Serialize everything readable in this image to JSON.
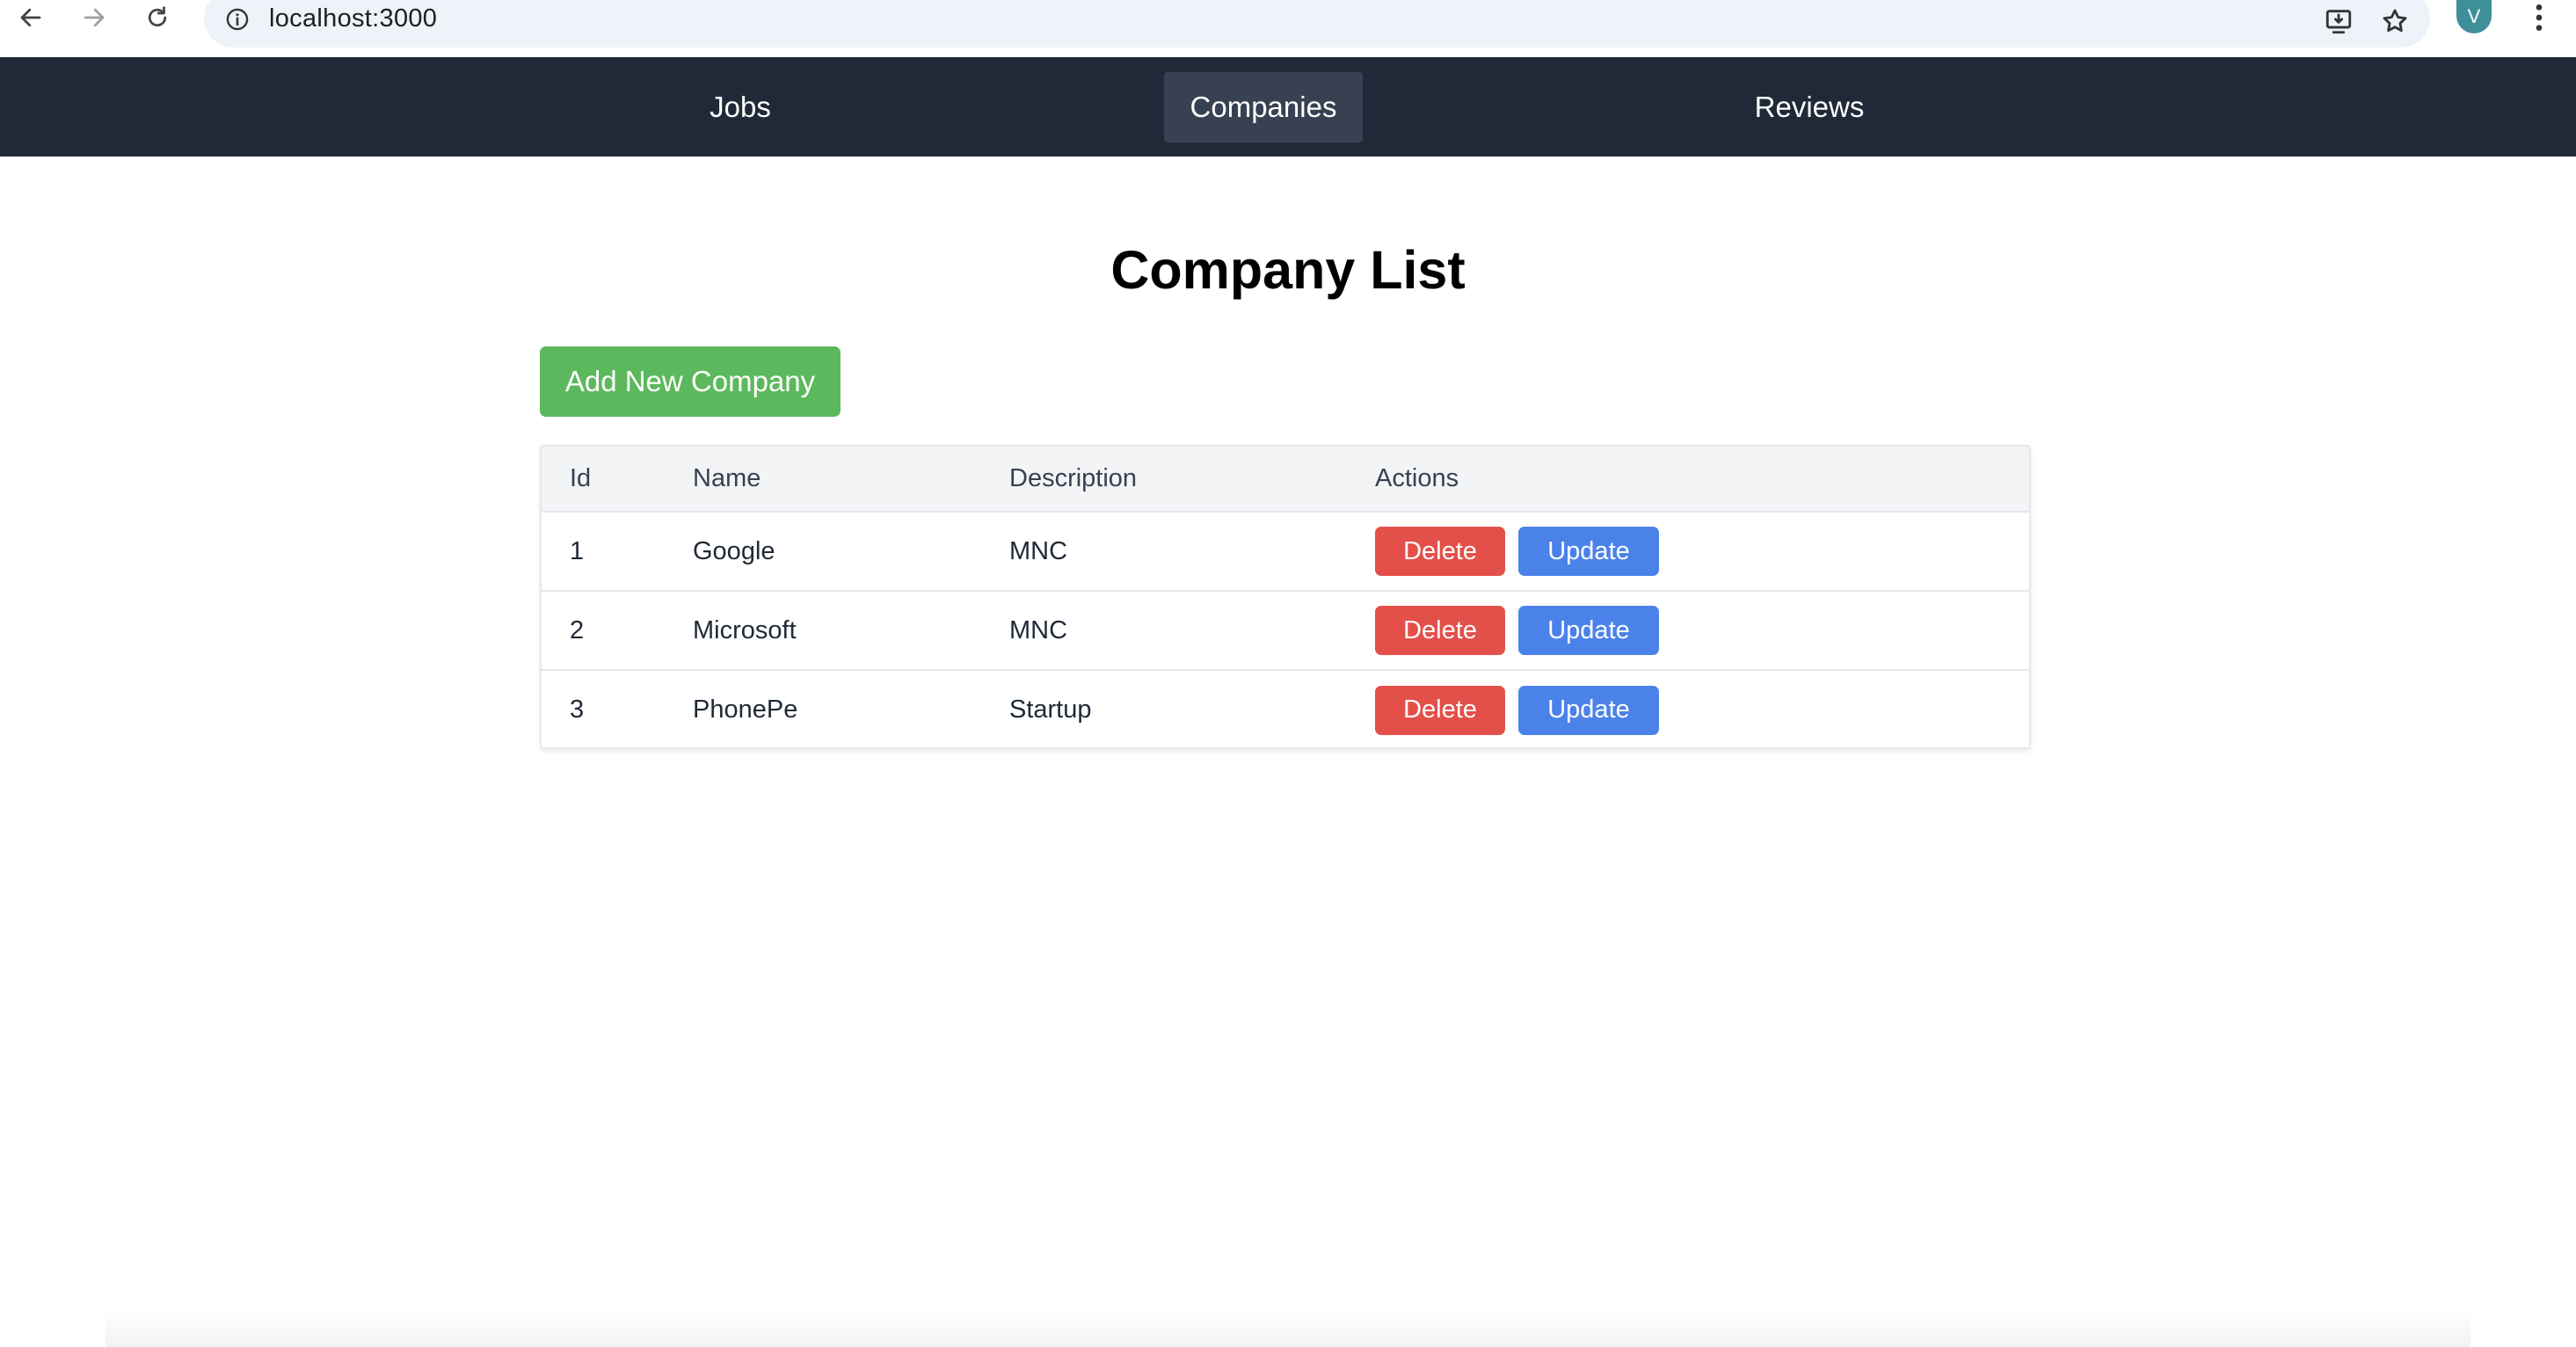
{
  "browser": {
    "url": "localhost:3000",
    "profile_initial": "V",
    "icons": [
      "back-icon",
      "forward-icon",
      "reload-icon",
      "info-icon",
      "install-app-icon",
      "star-icon",
      "more-icon"
    ]
  },
  "navbar": {
    "tabs": [
      {
        "label": "Jobs",
        "active": false
      },
      {
        "label": "Companies",
        "active": true
      },
      {
        "label": "Reviews",
        "active": false
      }
    ]
  },
  "page": {
    "title": "Company List",
    "add_button": "Add New Company"
  },
  "table": {
    "headers": [
      "Id",
      "Name",
      "Description",
      "Actions"
    ],
    "rows": [
      {
        "id": "1",
        "name": "Google",
        "description": "MNC"
      },
      {
        "id": "2",
        "name": "Microsoft",
        "description": "MNC"
      },
      {
        "id": "3",
        "name": "PhonePe",
        "description": "Startup"
      }
    ],
    "delete_label": "Delete",
    "update_label": "Update"
  },
  "colors": {
    "navbar_bg": "#1f2937",
    "active_tab_bg": "#374151",
    "add_button": "#5cb85c",
    "delete_button": "#e3504a",
    "update_button": "#4b82ea"
  }
}
